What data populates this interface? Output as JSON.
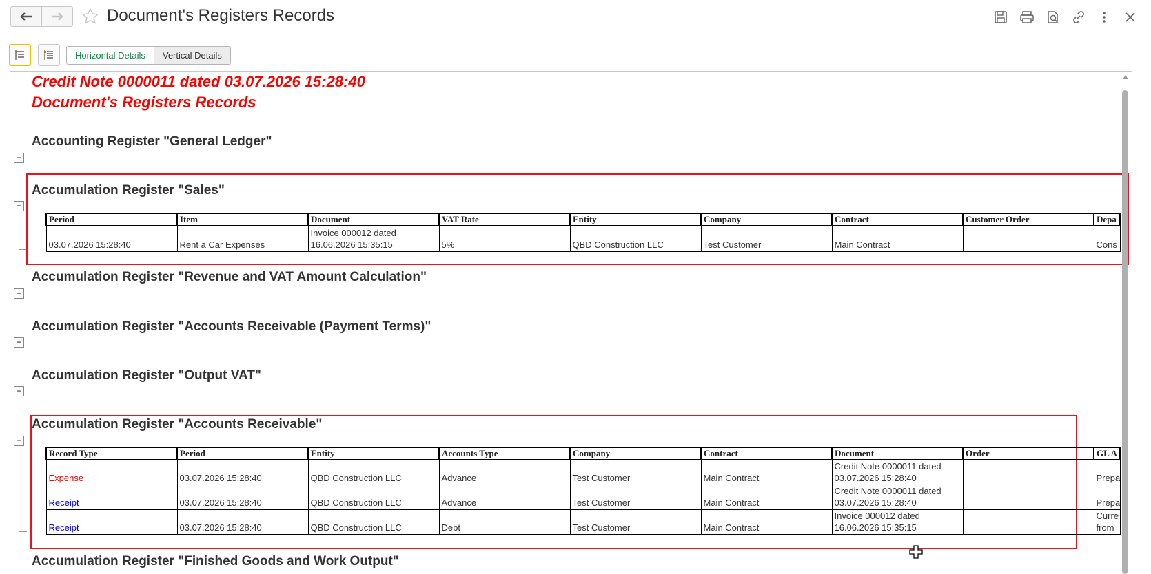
{
  "window": {
    "title": "Document's Registers Records"
  },
  "toolbar": {
    "horizontal_label": "Horizontal Details",
    "vertical_label": "Vertical Details"
  },
  "report": {
    "heading_line1": "Credit Note 0000011 dated 03.07.2026 15:28:40",
    "heading_line2": "Document's Registers Records",
    "sections": {
      "general_ledger": "Accounting Register \"General Ledger\"",
      "sales": "Accumulation Register \"Sales\"",
      "revenue_vat": "Accumulation Register \"Revenue and VAT Amount Calculation\"",
      "ar_payment_terms": "Accumulation Register \"Accounts Receivable (Payment Terms)\"",
      "output_vat": "Accumulation Register \"Output VAT\"",
      "accounts_receivable": "Accumulation Register \"Accounts Receivable\"",
      "finished_goods": "Accumulation Register \"Finished Goods and Work Output\""
    },
    "sales_table": {
      "headers": [
        "Period",
        "Item",
        "Document",
        "VAT Rate",
        "Entity",
        "Company",
        "Contract",
        "Customer Order",
        "Depa"
      ],
      "rows": [
        [
          "03.07.2026 15:28:40",
          "Rent a Car Expenses",
          "Invoice 000012 dated 16.06.2026 15:35:15",
          "5%",
          "QBD Construction LLC",
          "Test Customer",
          "Main Contract",
          "",
          "Cons"
        ]
      ]
    },
    "ar_table": {
      "headers": [
        "Record Type",
        "Period",
        "Entity",
        "Accounts Type",
        "Company",
        "Contract",
        "Document",
        "Order",
        "GL A"
      ],
      "rows": [
        [
          "Expense",
          "03.07.2026 15:28:40",
          "QBD Construction LLC",
          "Advance",
          "Test Customer",
          "Main Contract",
          "Credit Note 0000011 dated 03.07.2026 15:28:40",
          "",
          "Prepa"
        ],
        [
          "Receipt",
          "03.07.2026 15:28:40",
          "QBD Construction LLC",
          "Advance",
          "Test Customer",
          "Main Contract",
          "Credit Note 0000011 dated 03.07.2026 15:28:40",
          "",
          "Prepa"
        ],
        [
          "Receipt",
          "03.07.2026 15:28:40",
          "QBD Construction LLC",
          "Debt",
          "Test Customer",
          "Main Contract",
          "Invoice 000012 dated 16.06.2026 15:35:15",
          "",
          "Curre from"
        ]
      ],
      "record_type_colors": {
        "Expense": "#ff0000",
        "Receipt": "#0000ff"
      }
    }
  },
  "colors": {
    "highlight_box": "#e8141e",
    "report_heading": "#ff0000",
    "active_segment": "#108a3c"
  }
}
